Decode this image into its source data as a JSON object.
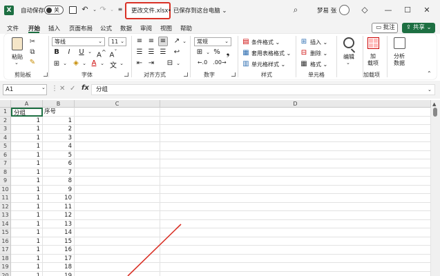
{
  "title_bar": {
    "autosave_label": "自动保存",
    "autosave_state": "关",
    "filename": "更改文件.xlsx",
    "saved_status": "• 已保存到这台电脑 ⌄",
    "username": "梦易 张"
  },
  "tabs": [
    "文件",
    "开始",
    "插入",
    "页面布局",
    "公式",
    "数据",
    "审阅",
    "视图",
    "帮助"
  ],
  "active_tab": "开始",
  "comment_button": "批注",
  "share_button": "共享 ⌄",
  "ribbon": {
    "clipboard": {
      "paste": "粘贴",
      "label": "剪贴板"
    },
    "font": {
      "name": "等线",
      "size": "11",
      "label": "字体"
    },
    "alignment": {
      "label": "对齐方式"
    },
    "number": {
      "format": "常规",
      "label": "数字"
    },
    "styles": {
      "conditional": "条件格式 ⌄",
      "table": "套用表格格式 ⌄",
      "cell": "单元格样式 ⌄",
      "label": "样式"
    },
    "cells": {
      "insert": "插入 ⌄",
      "delete": "删除 ⌄",
      "format": "格式 ⌄",
      "label": "单元格"
    },
    "editing": {
      "label": "编辑"
    },
    "addins": {
      "label1": "加",
      "label2": "载项",
      "group": "加载项"
    },
    "analyze": {
      "label1": "分析",
      "label2": "数据"
    }
  },
  "formula_bar": {
    "name_box": "A1",
    "value": "分组"
  },
  "columns": [
    "A",
    "B",
    "C",
    "D"
  ],
  "rows": [
    {
      "n": "1",
      "a": "分组",
      "b": "序号"
    },
    {
      "n": "2",
      "a": "1",
      "b": "1"
    },
    {
      "n": "3",
      "a": "1",
      "b": "2"
    },
    {
      "n": "4",
      "a": "1",
      "b": "3"
    },
    {
      "n": "5",
      "a": "1",
      "b": "4"
    },
    {
      "n": "6",
      "a": "1",
      "b": "5"
    },
    {
      "n": "7",
      "a": "1",
      "b": "6"
    },
    {
      "n": "8",
      "a": "1",
      "b": "7"
    },
    {
      "n": "9",
      "a": "1",
      "b": "8"
    },
    {
      "n": "10",
      "a": "1",
      "b": "9"
    },
    {
      "n": "11",
      "a": "1",
      "b": "10"
    },
    {
      "n": "12",
      "a": "1",
      "b": "11"
    },
    {
      "n": "13",
      "a": "1",
      "b": "12"
    },
    {
      "n": "14",
      "a": "1",
      "b": "13"
    },
    {
      "n": "15",
      "a": "1",
      "b": "14"
    },
    {
      "n": "16",
      "a": "1",
      "b": "15"
    },
    {
      "n": "17",
      "a": "1",
      "b": "16"
    },
    {
      "n": "18",
      "a": "1",
      "b": "17"
    },
    {
      "n": "19",
      "a": "1",
      "b": "18"
    },
    {
      "n": "20",
      "a": "1",
      "b": "19"
    }
  ],
  "colors": {
    "accent": "#1d6f42",
    "highlight": "#d93025"
  }
}
